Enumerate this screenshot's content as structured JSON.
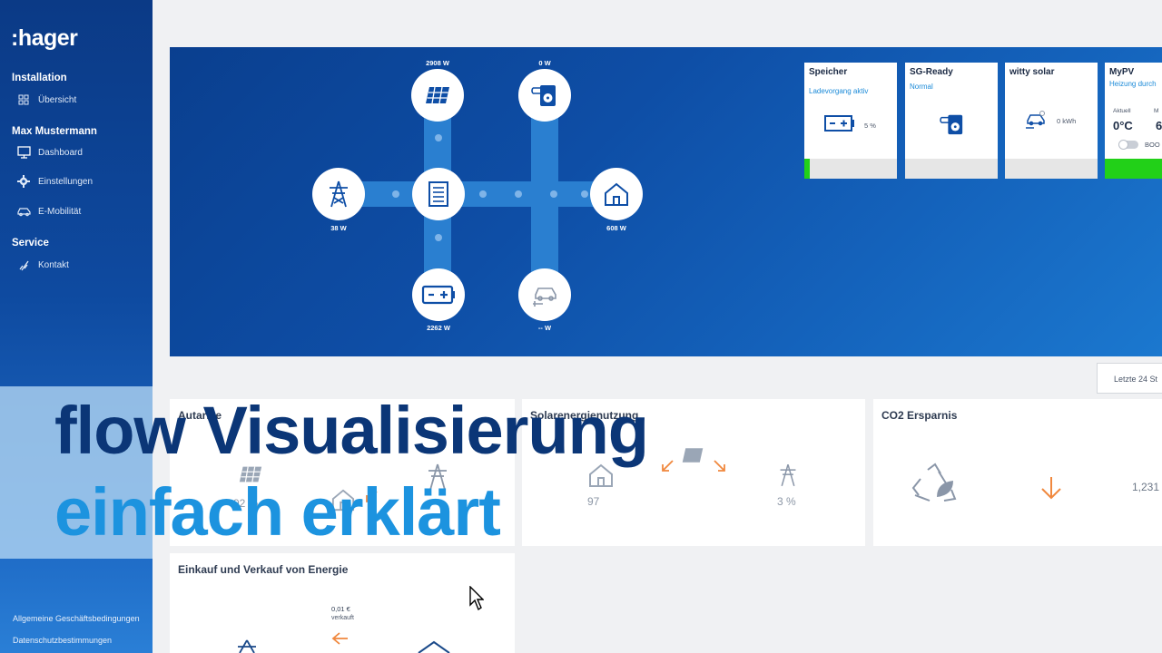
{
  "brand": {
    "logo_text": ":hager"
  },
  "sidebar": {
    "sections": [
      {
        "title": "Installation",
        "items": [
          {
            "label": "Übersicht",
            "icon": "grid-icon"
          }
        ]
      },
      {
        "title": "Max Mustermann",
        "items": [
          {
            "label": "Dashboard",
            "icon": "monitor-icon"
          },
          {
            "label": "Einstellungen",
            "icon": "gear-icon"
          },
          {
            "label": "E-Mobilität",
            "icon": "car-icon"
          }
        ]
      },
      {
        "title": "Service",
        "items": [
          {
            "label": "Kontakt",
            "icon": "phone-icon"
          }
        ]
      }
    ],
    "footer": [
      "Allgemeine Geschäftsbedingungen",
      "Datenschutzbestimmungen"
    ]
  },
  "flow": {
    "solar": "2908 W",
    "heat": "0 W",
    "grid": "38 W",
    "house": "608 W",
    "battery": "2262 W",
    "ev": "-- W"
  },
  "devices": [
    {
      "title": "Speicher",
      "status": "Ladevorgang aktiv",
      "value": "5 %"
    },
    {
      "title": "SG-Ready",
      "status": "Normal"
    },
    {
      "title": "witty solar",
      "status": "",
      "value": "0 kWh"
    },
    {
      "title": "MyPV",
      "status": "Heizung durch",
      "current_label": "Aktuell",
      "current_value": "0°C",
      "extra_label": "M",
      "extra_value": "6",
      "toggle_label": "BOO"
    }
  ],
  "range": {
    "label": "Letzte 24 St"
  },
  "tiles": {
    "autarkie": {
      "title": "Autarkie",
      "value": "92 %"
    },
    "solar": {
      "title": "Solarenergienutzung",
      "value": "97",
      "value2": "3 %"
    },
    "co2": {
      "title": "CO2 Ersparnis",
      "value": "1,231"
    },
    "trade": {
      "title": "Einkauf und Verkauf von Energie",
      "price": "0,01 €",
      "price_label": "verkauft"
    }
  },
  "overlay": {
    "line1": "flow Visualisierung",
    "line2": "einfach erklärt"
  },
  "colors": {
    "brand_dark": "#0b3a86",
    "accent_blue": "#1c93df",
    "headline_dark": "#0b3677",
    "green": "#22d018",
    "orange": "#f0883e"
  }
}
